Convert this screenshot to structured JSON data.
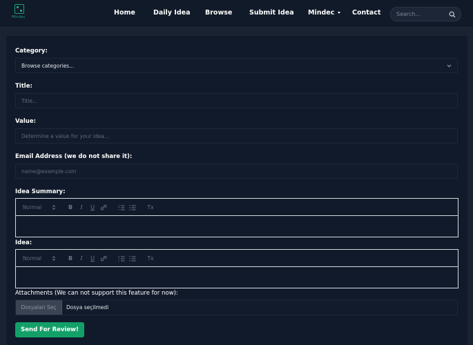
{
  "brand": {
    "logo_text": "Mindec",
    "accent": "#1aa57a"
  },
  "nav": {
    "items": [
      {
        "label": "Home"
      },
      {
        "label": "Daily Idea"
      },
      {
        "label": "Browse"
      },
      {
        "label": "Submit Idea"
      },
      {
        "label": "Mindec",
        "dropdown": true
      },
      {
        "label": "Contact"
      }
    ],
    "search_placeholder": "Search..."
  },
  "form": {
    "category": {
      "label": "Category:",
      "value": "Browse categories..."
    },
    "title": {
      "label": "Title:",
      "placeholder": "Title..."
    },
    "value": {
      "label": "Value:",
      "placeholder": "Determine a value for your idea..."
    },
    "email": {
      "label": "Email Address (we do not share it):",
      "placeholder": "name@example.com"
    },
    "summary": {
      "label": "Idea Summary:"
    },
    "idea": {
      "label": "Idea:"
    },
    "toolbar": {
      "heading": "Normal",
      "bold": "B",
      "italic": "I",
      "underline": "U",
      "clear": "Tx"
    },
    "attachments": {
      "label": "Attachments (We can not support this feature for now):",
      "button": "Dosyaları Seç",
      "status": "Dosya seçilmedi"
    },
    "submit_label": "Send For Review!",
    "submit_color": "#13a068"
  }
}
